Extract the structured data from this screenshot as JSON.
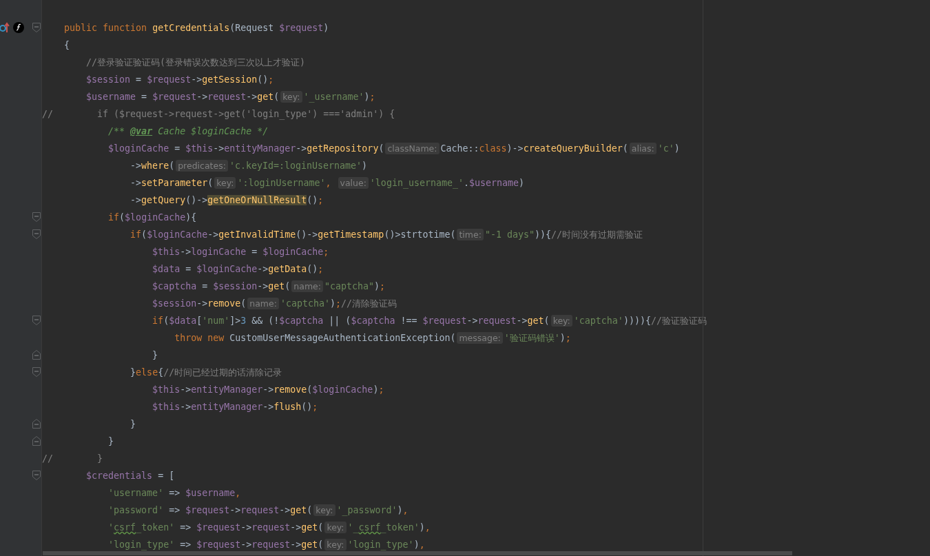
{
  "editor": {
    "lines": [
      {
        "fold_open": true,
        "gutter_icons": true,
        "tokens": [
          {
            "text": "    public function ",
            "kind": "k"
          },
          {
            "text": "getCredentials",
            "kind": "f"
          },
          {
            "text": "(Request ",
            "kind": "p"
          },
          {
            "text": "$request",
            "kind": "v"
          },
          {
            "text": ")",
            "kind": "p"
          }
        ]
      },
      {
        "tokens": [
          {
            "text": "    {",
            "kind": "p"
          }
        ]
      },
      {
        "tokens": [
          {
            "text": "        //登录验证验证码(登录错误次数达到三次以上才验证)",
            "kind": "c"
          }
        ]
      },
      {
        "tokens": [
          {
            "text": "        $session",
            "kind": "v"
          },
          {
            "text": " = ",
            "kind": "p"
          },
          {
            "text": "$request",
            "kind": "v"
          },
          {
            "text": "->",
            "kind": "p"
          },
          {
            "text": "getSession",
            "kind": "f"
          },
          {
            "text": "()",
            "kind": "p"
          },
          {
            "text": ";",
            "kind": "k"
          }
        ]
      },
      {
        "tokens": [
          {
            "text": "        $username",
            "kind": "v"
          },
          {
            "text": " = ",
            "kind": "p"
          },
          {
            "text": "$request",
            "kind": "v"
          },
          {
            "text": "->",
            "kind": "p"
          },
          {
            "text": "request",
            "kind": "v"
          },
          {
            "text": "->",
            "kind": "p"
          },
          {
            "text": "get",
            "kind": "f"
          },
          {
            "text": "(",
            "kind": "p"
          },
          {
            "text": "key:",
            "kind": "h"
          },
          {
            "text": "'_username'",
            "kind": "s"
          },
          {
            "text": ")",
            "kind": "p"
          },
          {
            "text": ";",
            "kind": "k"
          }
        ]
      },
      {
        "tokens": [
          {
            "text": "//        if ($request->request->get('login_type') ==='admin') {",
            "kind": "c"
          }
        ]
      },
      {
        "tokens": [
          {
            "text": "            /** ",
            "kind": "d"
          },
          {
            "text": "@var",
            "kind": "dt"
          },
          {
            "text": " Cache $loginCache */",
            "kind": "d"
          }
        ]
      },
      {
        "tokens": [
          {
            "text": "            $loginCache",
            "kind": "v"
          },
          {
            "text": " = ",
            "kind": "p"
          },
          {
            "text": "$this",
            "kind": "v"
          },
          {
            "text": "->",
            "kind": "p"
          },
          {
            "text": "entityManager",
            "kind": "v"
          },
          {
            "text": "->",
            "kind": "p"
          },
          {
            "text": "getRepository",
            "kind": "f"
          },
          {
            "text": "(",
            "kind": "p"
          },
          {
            "text": "className:",
            "kind": "h"
          },
          {
            "text": "Cache::",
            "kind": "p"
          },
          {
            "text": "class",
            "kind": "k"
          },
          {
            "text": ")->",
            "kind": "p"
          },
          {
            "text": "createQueryBuilder",
            "kind": "f"
          },
          {
            "text": "(",
            "kind": "p"
          },
          {
            "text": "alias:",
            "kind": "h"
          },
          {
            "text": "'c'",
            "kind": "s"
          },
          {
            "text": ")",
            "kind": "p"
          }
        ]
      },
      {
        "tokens": [
          {
            "text": "                ->",
            "kind": "p"
          },
          {
            "text": "where",
            "kind": "f"
          },
          {
            "text": "(",
            "kind": "p"
          },
          {
            "text": "predicates:",
            "kind": "h"
          },
          {
            "text": "'c.keyId=:loginUsername'",
            "kind": "s"
          },
          {
            "text": ")",
            "kind": "p"
          }
        ]
      },
      {
        "tokens": [
          {
            "text": "                ->",
            "kind": "p"
          },
          {
            "text": "setParameter",
            "kind": "f"
          },
          {
            "text": "(",
            "kind": "p"
          },
          {
            "text": "key:",
            "kind": "h"
          },
          {
            "text": "':loginUsername'",
            "kind": "s"
          },
          {
            "text": ", ",
            "kind": "k"
          },
          {
            "text": "value:",
            "kind": "h"
          },
          {
            "text": "'login_username_'",
            "kind": "s"
          },
          {
            "text": ".",
            "kind": "p"
          },
          {
            "text": "$username",
            "kind": "v"
          },
          {
            "text": ")",
            "kind": "p"
          }
        ]
      },
      {
        "tokens": [
          {
            "text": "                ->",
            "kind": "p"
          },
          {
            "text": "getQuery",
            "kind": "f"
          },
          {
            "text": "()->",
            "kind": "p"
          },
          {
            "text": "getOneOrNullResult",
            "kind": "m"
          },
          {
            "text": "()",
            "kind": "p"
          },
          {
            "text": ";",
            "kind": "k"
          }
        ]
      },
      {
        "fold_open": true,
        "tokens": [
          {
            "text": "            if",
            "kind": "k"
          },
          {
            "text": "(",
            "kind": "p"
          },
          {
            "text": "$loginCache",
            "kind": "v"
          },
          {
            "text": "){",
            "kind": "p"
          }
        ]
      },
      {
        "fold_open": true,
        "tokens": [
          {
            "text": "                if",
            "kind": "k"
          },
          {
            "text": "(",
            "kind": "p"
          },
          {
            "text": "$loginCache",
            "kind": "v"
          },
          {
            "text": "->",
            "kind": "p"
          },
          {
            "text": "getInvalidTime",
            "kind": "f"
          },
          {
            "text": "()->",
            "kind": "p"
          },
          {
            "text": "getTimestamp",
            "kind": "f"
          },
          {
            "text": "()>strtotime(",
            "kind": "p"
          },
          {
            "text": "time:",
            "kind": "h"
          },
          {
            "text": "\"-1 days\"",
            "kind": "s"
          },
          {
            "text": ")){",
            "kind": "p"
          },
          {
            "text": "//时间没有过期需验证",
            "kind": "c"
          }
        ]
      },
      {
        "tokens": [
          {
            "text": "                    $this",
            "kind": "v"
          },
          {
            "text": "->",
            "kind": "p"
          },
          {
            "text": "loginCache",
            "kind": "v"
          },
          {
            "text": " = ",
            "kind": "p"
          },
          {
            "text": "$loginCache",
            "kind": "v"
          },
          {
            "text": ";",
            "kind": "k"
          }
        ]
      },
      {
        "tokens": [
          {
            "text": "                    $data",
            "kind": "v"
          },
          {
            "text": " = ",
            "kind": "p"
          },
          {
            "text": "$loginCache",
            "kind": "v"
          },
          {
            "text": "->",
            "kind": "p"
          },
          {
            "text": "getData",
            "kind": "f"
          },
          {
            "text": "()",
            "kind": "p"
          },
          {
            "text": ";",
            "kind": "k"
          }
        ]
      },
      {
        "tokens": [
          {
            "text": "                    $captcha",
            "kind": "v"
          },
          {
            "text": " = ",
            "kind": "p"
          },
          {
            "text": "$session",
            "kind": "v"
          },
          {
            "text": "->",
            "kind": "p"
          },
          {
            "text": "get",
            "kind": "f"
          },
          {
            "text": "(",
            "kind": "p"
          },
          {
            "text": "name:",
            "kind": "h"
          },
          {
            "text": "\"captcha\"",
            "kind": "s"
          },
          {
            "text": ")",
            "kind": "p"
          },
          {
            "text": ";",
            "kind": "k"
          }
        ]
      },
      {
        "tokens": [
          {
            "text": "                    $session",
            "kind": "v"
          },
          {
            "text": "->",
            "kind": "p"
          },
          {
            "text": "remove",
            "kind": "f"
          },
          {
            "text": "(",
            "kind": "p"
          },
          {
            "text": "name:",
            "kind": "h"
          },
          {
            "text": "'captcha'",
            "kind": "s"
          },
          {
            "text": ")",
            "kind": "p"
          },
          {
            "text": ";",
            "kind": "k"
          },
          {
            "text": "//清除验证码",
            "kind": "c"
          }
        ]
      },
      {
        "fold_open": true,
        "tokens": [
          {
            "text": "                    if",
            "kind": "k"
          },
          {
            "text": "(",
            "kind": "p"
          },
          {
            "text": "$data",
            "kind": "v"
          },
          {
            "text": "[",
            "kind": "p"
          },
          {
            "text": "'num'",
            "kind": "s"
          },
          {
            "text": "]>",
            "kind": "p"
          },
          {
            "text": "3",
            "kind": "n"
          },
          {
            "text": " && (!",
            "kind": "p"
          },
          {
            "text": "$captcha",
            "kind": "v"
          },
          {
            "text": " || (",
            "kind": "p"
          },
          {
            "text": "$captcha",
            "kind": "v"
          },
          {
            "text": " !== ",
            "kind": "p"
          },
          {
            "text": "$request",
            "kind": "v"
          },
          {
            "text": "->",
            "kind": "p"
          },
          {
            "text": "request",
            "kind": "v"
          },
          {
            "text": "->",
            "kind": "p"
          },
          {
            "text": "get",
            "kind": "f"
          },
          {
            "text": "(",
            "kind": "p"
          },
          {
            "text": "key:",
            "kind": "h"
          },
          {
            "text": "'captcha'",
            "kind": "s"
          },
          {
            "text": ")))){",
            "kind": "p"
          },
          {
            "text": "//验证验证码",
            "kind": "c"
          }
        ]
      },
      {
        "tokens": [
          {
            "text": "                        throw new ",
            "kind": "k"
          },
          {
            "text": "CustomUserMessageAuthenticationException(",
            "kind": "p"
          },
          {
            "text": "message:",
            "kind": "h"
          },
          {
            "text": "'验证码错误'",
            "kind": "s"
          },
          {
            "text": ")",
            "kind": "p"
          },
          {
            "text": ";",
            "kind": "k"
          }
        ]
      },
      {
        "fold_close": true,
        "tokens": [
          {
            "text": "                    }",
            "kind": "p"
          }
        ]
      },
      {
        "fold_open": true,
        "tokens": [
          {
            "text": "                }",
            "kind": "p"
          },
          {
            "text": "else",
            "kind": "k"
          },
          {
            "text": "{",
            "kind": "p"
          },
          {
            "text": "//时间已经过期的话清除记录",
            "kind": "c"
          }
        ]
      },
      {
        "tokens": [
          {
            "text": "                    $this",
            "kind": "v"
          },
          {
            "text": "->",
            "kind": "p"
          },
          {
            "text": "entityManager",
            "kind": "v"
          },
          {
            "text": "->",
            "kind": "p"
          },
          {
            "text": "remove",
            "kind": "f"
          },
          {
            "text": "(",
            "kind": "p"
          },
          {
            "text": "$loginCache",
            "kind": "v"
          },
          {
            "text": ")",
            "kind": "p"
          },
          {
            "text": ";",
            "kind": "k"
          }
        ]
      },
      {
        "tokens": [
          {
            "text": "                    $this",
            "kind": "v"
          },
          {
            "text": "->",
            "kind": "p"
          },
          {
            "text": "entityManager",
            "kind": "v"
          },
          {
            "text": "->",
            "kind": "p"
          },
          {
            "text": "flush",
            "kind": "f"
          },
          {
            "text": "()",
            "kind": "p"
          },
          {
            "text": ";",
            "kind": "k"
          }
        ]
      },
      {
        "fold_close": true,
        "tokens": [
          {
            "text": "                }",
            "kind": "p"
          }
        ]
      },
      {
        "fold_close": true,
        "tokens": [
          {
            "text": "            }",
            "kind": "p"
          }
        ]
      },
      {
        "tokens": [
          {
            "text": "//        }",
            "kind": "c"
          }
        ]
      },
      {
        "fold_open": true,
        "tokens": [
          {
            "text": "        $credentials",
            "kind": "v"
          },
          {
            "text": " = [",
            "kind": "p"
          }
        ]
      },
      {
        "tokens": [
          {
            "text": "            'username'",
            "kind": "s"
          },
          {
            "text": " => ",
            "kind": "p"
          },
          {
            "text": "$username",
            "kind": "v"
          },
          {
            "text": ",",
            "kind": "k"
          }
        ]
      },
      {
        "tokens": [
          {
            "text": "            'password'",
            "kind": "s"
          },
          {
            "text": " => ",
            "kind": "p"
          },
          {
            "text": "$request",
            "kind": "v"
          },
          {
            "text": "->",
            "kind": "p"
          },
          {
            "text": "request",
            "kind": "v"
          },
          {
            "text": "->",
            "kind": "p"
          },
          {
            "text": "get",
            "kind": "f"
          },
          {
            "text": "(",
            "kind": "p"
          },
          {
            "text": "key:",
            "kind": "h"
          },
          {
            "text": "'_password'",
            "kind": "s"
          },
          {
            "text": ")",
            "kind": "p"
          },
          {
            "text": ",",
            "kind": "k"
          }
        ]
      },
      {
        "tokens": [
          {
            "text": "            '",
            "kind": "s"
          },
          {
            "text": "csrf",
            "kind": "t"
          },
          {
            "text": "_token'",
            "kind": "s"
          },
          {
            "text": " => ",
            "kind": "p"
          },
          {
            "text": "$request",
            "kind": "v"
          },
          {
            "text": "->",
            "kind": "p"
          },
          {
            "text": "request",
            "kind": "v"
          },
          {
            "text": "->",
            "kind": "p"
          },
          {
            "text": "get",
            "kind": "f"
          },
          {
            "text": "(",
            "kind": "p"
          },
          {
            "text": "key:",
            "kind": "h"
          },
          {
            "text": "'_",
            "kind": "s"
          },
          {
            "text": "csrf",
            "kind": "t"
          },
          {
            "text": "_token'",
            "kind": "s"
          },
          {
            "text": ")",
            "kind": "p"
          },
          {
            "text": ",",
            "kind": "k"
          }
        ]
      },
      {
        "tokens": [
          {
            "text": "            'login_type'",
            "kind": "s"
          },
          {
            "text": " => ",
            "kind": "p"
          },
          {
            "text": "$request",
            "kind": "v"
          },
          {
            "text": "->",
            "kind": "p"
          },
          {
            "text": "request",
            "kind": "v"
          },
          {
            "text": "->",
            "kind": "p"
          },
          {
            "text": "get",
            "kind": "f"
          },
          {
            "text": "(",
            "kind": "p"
          },
          {
            "text": "key:",
            "kind": "h"
          },
          {
            "text": "'login_type'",
            "kind": "s"
          },
          {
            "text": ")",
            "kind": "p"
          },
          {
            "text": ",",
            "kind": "k"
          }
        ]
      }
    ]
  }
}
